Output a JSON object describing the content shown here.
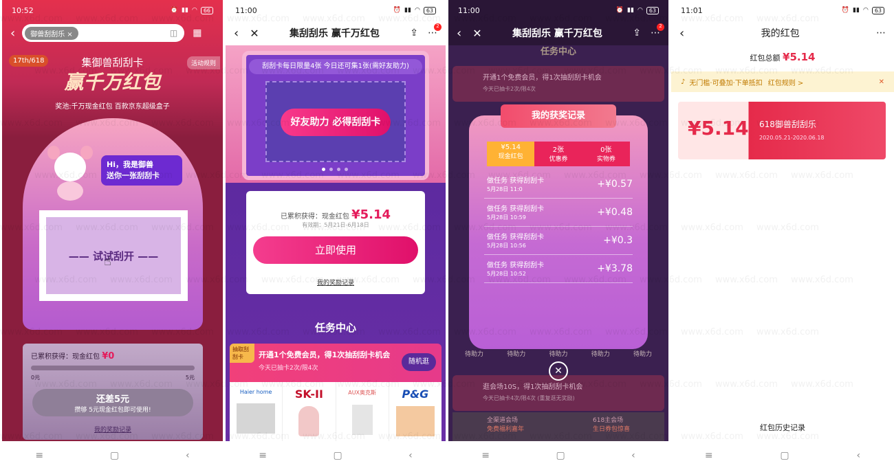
{
  "p1": {
    "time": "10:52",
    "battery": "66",
    "search_tag": "御兽刮刮乐",
    "badge": "17th/618",
    "rules": "活动规则",
    "headline_top": "集御兽刮刮卡",
    "headline_main": "赢千万红包",
    "prize_line": "奖池:千万现金红包 百款京东超级盒子",
    "mascot_line1": "Hi，我是御兽",
    "mascot_line2": "送你一张刮刮卡",
    "scratch_text": "——  试试刮开  ——",
    "earned_label": "已累积获得：现金红包",
    "earned_value": "¥0",
    "progress_min": "0元",
    "progress_max": "5元",
    "btn_label": "还差5元",
    "btn_sub": "攒够 5元现金红包即可使用!",
    "record_link": "我的奖励记录"
  },
  "p2": {
    "time": "11:00",
    "battery": "63",
    "title": "集刮刮乐 赢千万红包",
    "notif_count": "2",
    "limit_text": "刮刮卡每日限量4张 今日还可集1张(需好友助力)",
    "friend_btn": "好友助力 必得刮刮卡",
    "earned_label": "已累积获得：现金红包",
    "earned_value": "¥5.14",
    "valid": "有效期：5月21日-6月18日",
    "use_btn": "立即使用",
    "record_link": "我的奖励记录",
    "task_title": "任务中心",
    "task_tag": "抽取刮刮卡",
    "task_text": "开通1个免费会员，得1次抽刮刮卡机会",
    "task_sub": "今天已抽卡2次/限4次",
    "task_btn": "随机逛",
    "brands": [
      "Haier home",
      "SK-II",
      "AUX奥克斯",
      "P&G"
    ]
  },
  "p3": {
    "time": "11:00",
    "battery": "63",
    "title": "集刮刮乐 赢千万红包",
    "notif_count": "2",
    "bg_task_title": "任务中心",
    "bg_task_text": "开通1个免费会员，得1次抽刮刮卡机会",
    "bg_task_sub": "今天已抽卡2次/限4次",
    "bg_task2_text": "逛会场10S，得1次抽刮刮卡机会",
    "bg_task2_sub": "今天已抽卡4次/限4次 (重复逛无奖励)",
    "bg_venue1": "全渠道会场",
    "bg_venue1b": "免费福利嘉年",
    "bg_venue2": "618主会场",
    "bg_venue2b": "生日券包惊喜",
    "modal_title": "我的获奖记录",
    "tabs": [
      {
        "value": "¥5.14",
        "label": "现金红包"
      },
      {
        "value": "2张",
        "label": "优惠券"
      },
      {
        "value": "0张",
        "label": "实物券"
      }
    ],
    "records": [
      {
        "title": "做任务 获得刮刮卡",
        "date": "5月28日 11:0",
        "amount": "+¥0.57"
      },
      {
        "title": "做任务 获得刮刮卡",
        "date": "5月28日 10:59",
        "amount": "+¥0.48"
      },
      {
        "title": "做任务 获得刮刮卡",
        "date": "5月28日 10:56",
        "amount": "+¥0.3"
      },
      {
        "title": "做任务 获得刮刮卡",
        "date": "5月28日 10:52",
        "amount": "+¥3.78"
      }
    ],
    "helpers": [
      "待助力",
      "待助力",
      "待助力",
      "待助力",
      "待助力"
    ]
  },
  "p4": {
    "time": "11:01",
    "battery": "63",
    "title": "我的红包",
    "total_label": "红包总额",
    "total_value": "¥5.14",
    "notice": "无门槛·可叠加·下单抵扣",
    "notice_link": "红包规则 >",
    "card_value": "¥5.14",
    "card_name": "618御兽刮刮乐",
    "card_date": "2020.05.21-2020.06.18",
    "history_link": "红包历史记录"
  },
  "watermark": "www.x6d.com",
  "colors": {
    "accent": "#f2166b",
    "gold": "#ffd54a",
    "brand_red": "#e52a4a"
  }
}
